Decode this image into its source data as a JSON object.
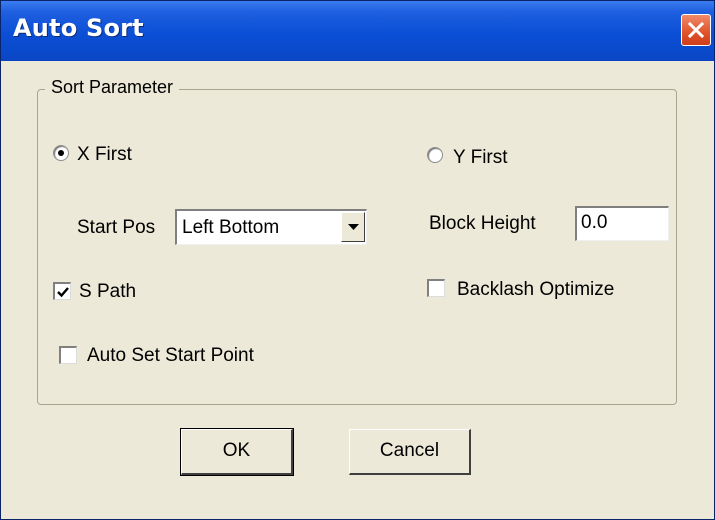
{
  "window": {
    "title": "Auto Sort",
    "close_icon": "close-icon"
  },
  "group": {
    "label": "Sort Parameter"
  },
  "sort_order": {
    "x_first": {
      "label": "X First",
      "selected": true
    },
    "y_first": {
      "label": "Y First",
      "selected": false
    }
  },
  "start_pos": {
    "label": "Start Pos",
    "value": "Left Bottom"
  },
  "block_height": {
    "label": "Block Height",
    "value": "0.0"
  },
  "s_path": {
    "label": "S Path",
    "checked": true
  },
  "backlash_optimize": {
    "label": "Backlash Optimize",
    "checked": false
  },
  "auto_set_start_point": {
    "label": "Auto Set Start Point",
    "checked": false
  },
  "buttons": {
    "ok": "OK",
    "cancel": "Cancel"
  }
}
